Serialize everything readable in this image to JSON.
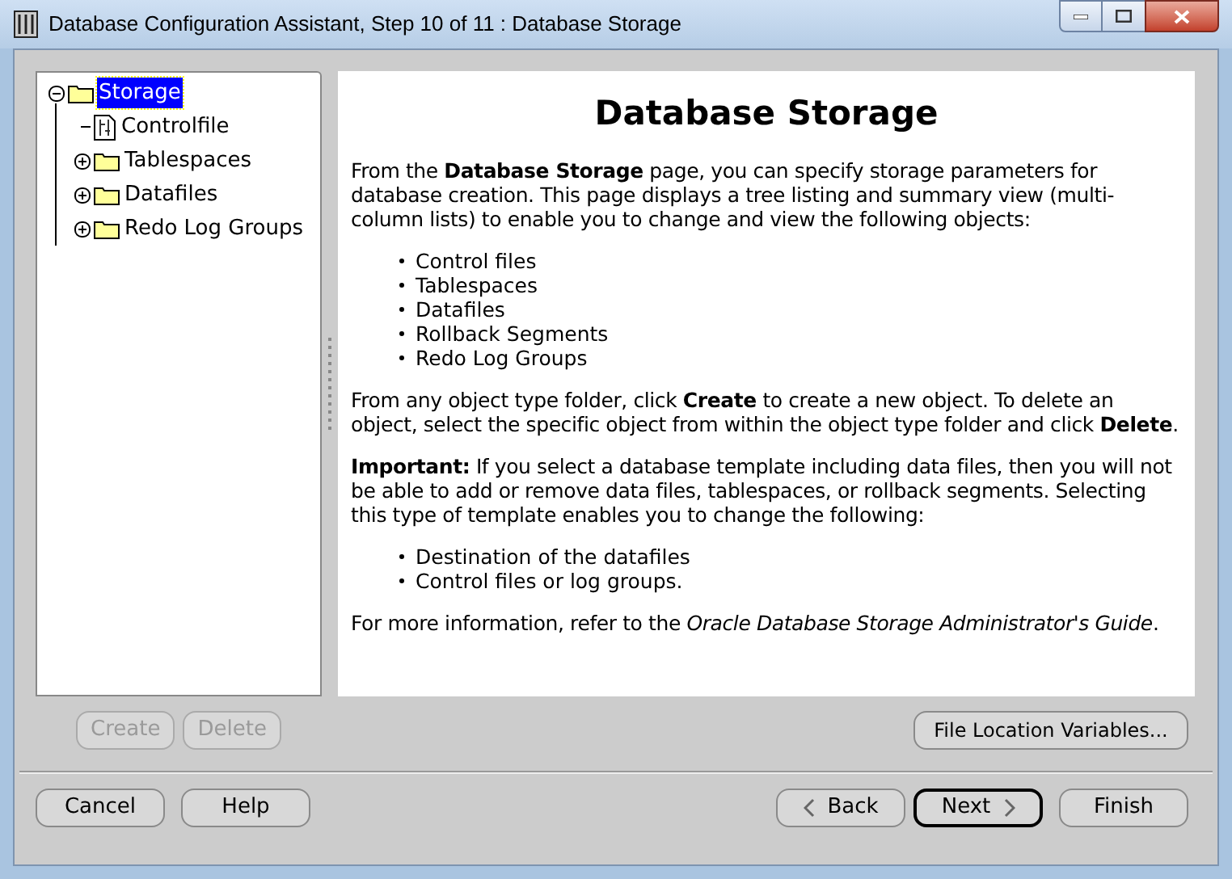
{
  "window": {
    "title": "Database Configuration Assistant, Step 10 of 11 : Database Storage"
  },
  "tree": [
    {
      "label": "Storage",
      "kind": "folder",
      "expanded": true,
      "selected": true,
      "children": [
        {
          "label": "Controlfile",
          "kind": "file",
          "selected": false
        },
        {
          "label": "Tablespaces",
          "kind": "folder",
          "expanded": false,
          "selected": false
        },
        {
          "label": "Datafiles",
          "kind": "folder",
          "expanded": false,
          "selected": false
        },
        {
          "label": "Redo Log Groups",
          "kind": "folder",
          "expanded": false,
          "selected": false
        }
      ]
    }
  ],
  "tree_buttons": [
    {
      "label": "Create",
      "disabled": true
    },
    {
      "label": "Delete",
      "disabled": true
    }
  ],
  "help": {
    "heading": "Database Storage",
    "blocks": [
      {
        "kind": "paragraph",
        "text": "From the **Database Storage** page, you can specify storage parameters for database creation. This page displays a tree listing and summary view (multi-column lists) to enable you to change and view the following objects:"
      },
      {
        "kind": "list",
        "items": [
          "Control files",
          "Tablespaces",
          "Datafiles",
          "Rollback Segments",
          "Redo Log Groups"
        ]
      },
      {
        "kind": "paragraph",
        "text": "From any object type folder, click **Create** to create a new object. To delete an object, select the specific object from within the object type folder and click **Delete**."
      },
      {
        "kind": "paragraph",
        "text": "**Important:** If you select a database template including data files, then you will not be able to add or remove data files, tablespaces, or rollback segments. Selecting this type of template enables you to change the following:"
      },
      {
        "kind": "list",
        "items": [
          "Destination of the datafiles",
          "Control files or log groups."
        ]
      },
      {
        "kind": "paragraph",
        "text": "For more information, refer to the *Oracle Database Storage Administrator's Guide*."
      }
    ]
  },
  "file_location_button": {
    "label": "File Location Variables..."
  },
  "footer_left": [
    {
      "label": "Cancel"
    },
    {
      "label": "Help"
    }
  ],
  "footer_right": [
    {
      "label": "Back",
      "kind": "back",
      "default": false
    },
    {
      "label": "Next",
      "kind": "next",
      "default": true
    },
    {
      "label": "Finish",
      "kind": "plain",
      "default": false
    }
  ]
}
